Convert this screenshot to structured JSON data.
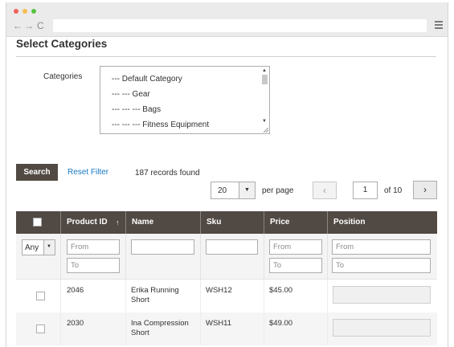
{
  "page": {
    "title": "Select Categories"
  },
  "categories": {
    "label": "Categories",
    "options": [
      "--- Default Category",
      "--- --- Gear",
      "--- --- --- Bags",
      "--- --- --- Fitness Equipment"
    ]
  },
  "actions": {
    "search_label": "Search",
    "reset_label": "Reset Filter",
    "records_found": "187 records found"
  },
  "pager": {
    "per_page_value": "20",
    "per_page_label": "per page",
    "current_page": "1",
    "of_pages": "of 10",
    "prev_icon": "‹",
    "next_icon": "›"
  },
  "grid": {
    "columns": [
      "Product ID",
      "Name",
      "Sku",
      "Price",
      "Position"
    ],
    "sort_indicator": "↑",
    "filters": {
      "any": "Any",
      "id_from": "From",
      "id_to": "To",
      "price_from": "From",
      "price_to": "To",
      "position_from": "From",
      "position_to": "To"
    },
    "rows": [
      {
        "id": "2046",
        "name_line1": "Erika Running",
        "name_line2": "Short",
        "sku": "WSH12",
        "price": "$45.00"
      },
      {
        "id": "2030",
        "name_line1": "Ina Compression",
        "name_line2": "Short",
        "sku": "WSH11",
        "price": "$49.00"
      }
    ]
  },
  "colors": {
    "header_bg": "#514943",
    "button_bg": "#514943",
    "link": "#1979c3"
  },
  "icons": {
    "back": "←",
    "forward": "→",
    "reload": "C",
    "dropdown": "▼"
  }
}
